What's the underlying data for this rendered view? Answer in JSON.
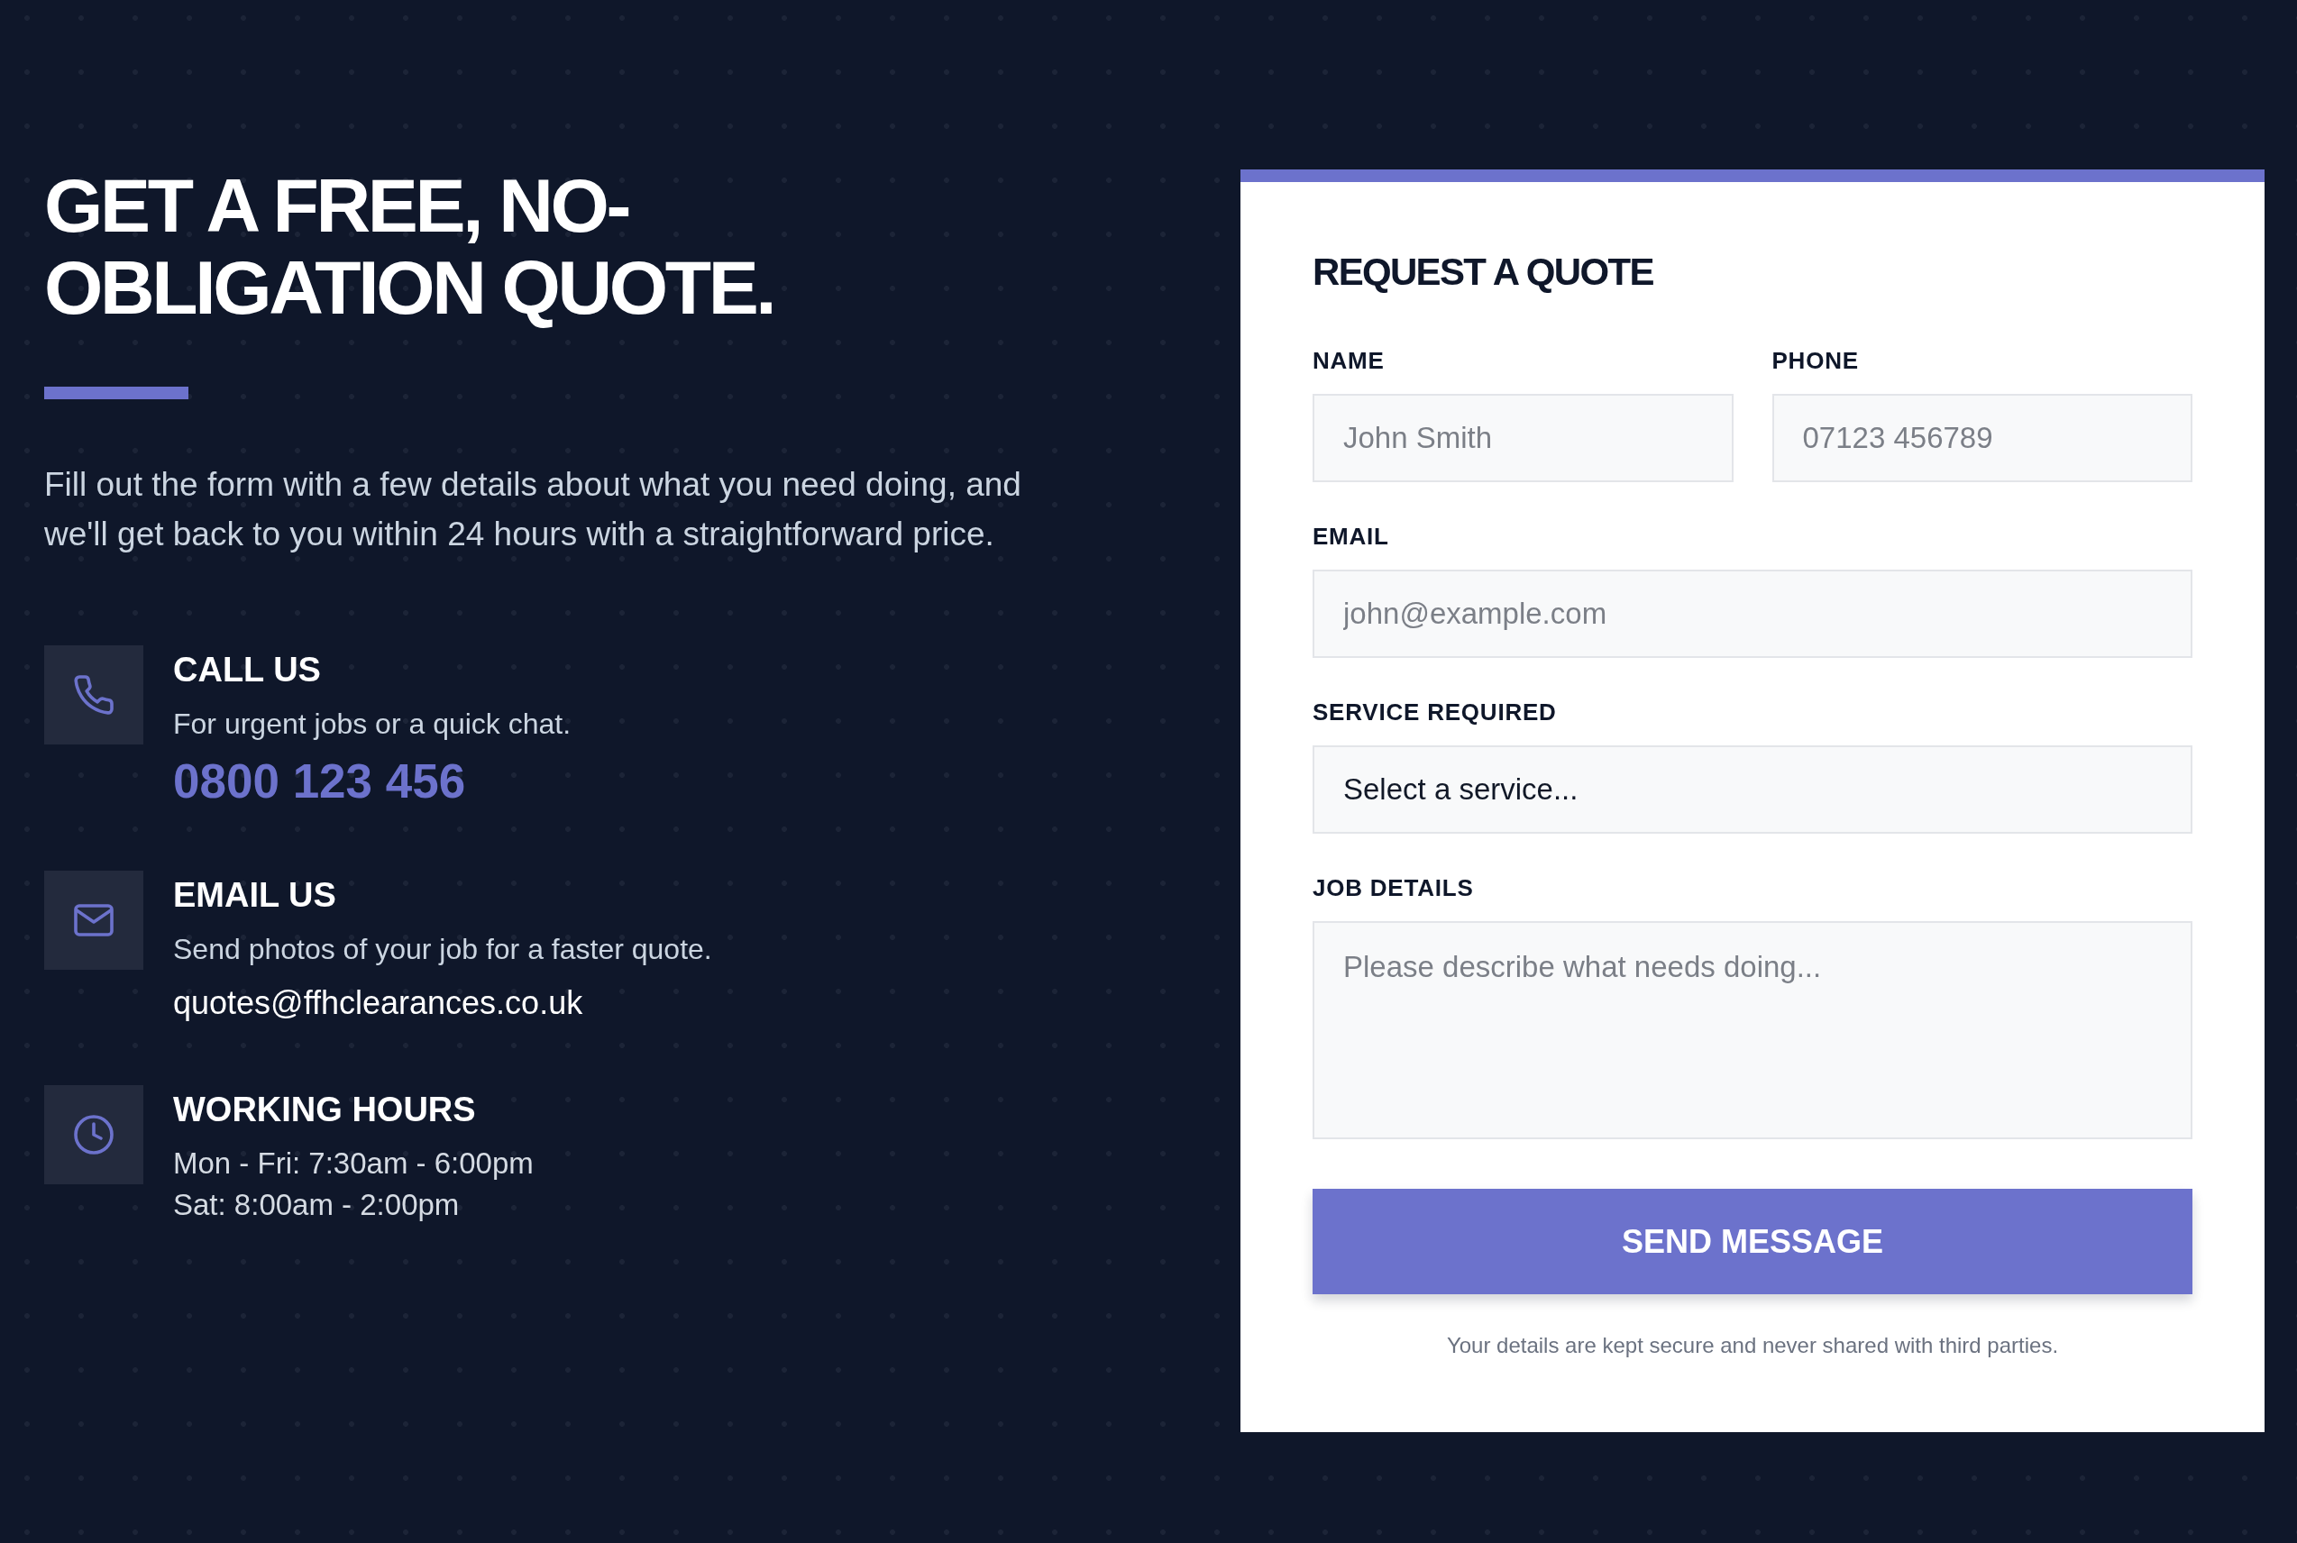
{
  "intro": {
    "heading": "GET A FREE, NO-OBLIGATION QUOTE.",
    "text": "Fill out the form with a few details about what you need doing, and we'll get back to you within 24 hours with a straightforward price."
  },
  "contacts": [
    {
      "kind": "phone",
      "title": "CALL US",
      "description": "For urgent jobs or a quick chat.",
      "link": "0800 123 456"
    },
    {
      "kind": "email",
      "title": "EMAIL US",
      "description": "Send photos of your job for a faster quote.",
      "link": "quotes@ffhclearances.co.uk"
    },
    {
      "kind": "hours",
      "title": "WORKING HOURS",
      "lines": [
        "Mon - Fri: 7:30am - 6:00pm",
        "Sat: 8:00am - 2:00pm"
      ]
    }
  ],
  "form": {
    "title": "REQUEST A QUOTE",
    "rows": [
      [
        {
          "kind": "text",
          "label": "NAME",
          "placeholder": "John Smith"
        },
        {
          "kind": "text",
          "label": "PHONE",
          "placeholder": "07123 456789"
        }
      ],
      [
        {
          "kind": "text",
          "label": "EMAIL",
          "placeholder": "john@example.com"
        }
      ],
      [
        {
          "kind": "select",
          "label": "SERVICE REQUIRED",
          "value": "Select a service..."
        }
      ],
      [
        {
          "kind": "textarea",
          "label": "JOB DETAILS",
          "placeholder": "Please describe what needs doing..."
        }
      ]
    ],
    "submit": "SEND MESSAGE",
    "note": "Your details are kept secure and never shared with third parties."
  }
}
